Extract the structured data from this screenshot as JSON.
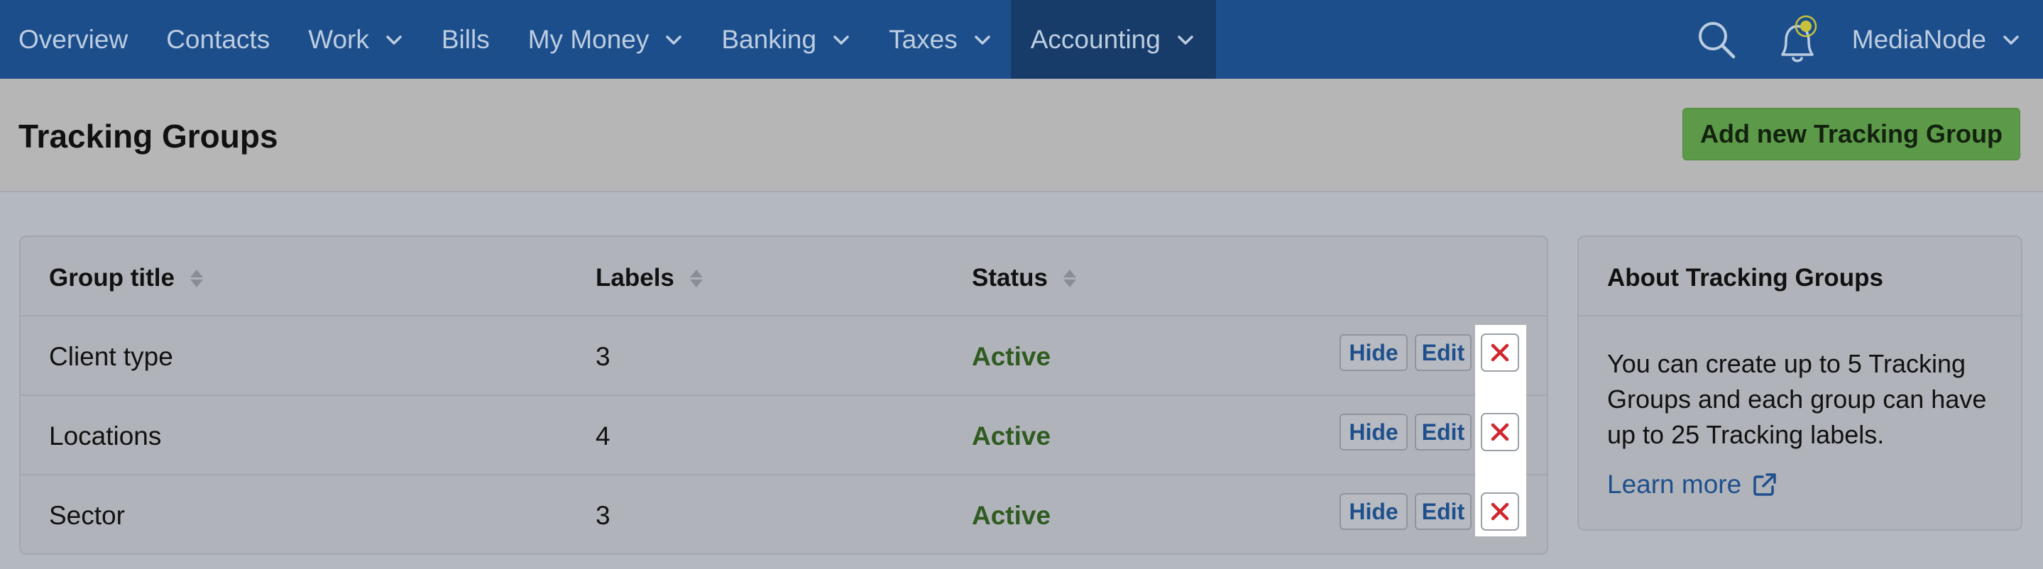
{
  "nav": {
    "items": [
      {
        "label": "Overview",
        "dropdown": false
      },
      {
        "label": "Contacts",
        "dropdown": false
      },
      {
        "label": "Work",
        "dropdown": true
      },
      {
        "label": "Bills",
        "dropdown": false
      },
      {
        "label": "My Money",
        "dropdown": true
      },
      {
        "label": "Banking",
        "dropdown": true
      },
      {
        "label": "Taxes",
        "dropdown": true
      },
      {
        "label": "Accounting",
        "dropdown": true,
        "active": true
      }
    ],
    "search_icon": "search-icon",
    "bell_icon": "notification-bell-icon",
    "user": "MediaNode"
  },
  "header": {
    "title": "Tracking Groups",
    "add_button": "Add new Tracking Group"
  },
  "table": {
    "columns": [
      "Group title",
      "Labels",
      "Status"
    ],
    "rows": [
      {
        "title": "Client type",
        "labels": "3",
        "status": "Active"
      },
      {
        "title": "Locations",
        "labels": "4",
        "status": "Active"
      },
      {
        "title": "Sector",
        "labels": "3",
        "status": "Active"
      }
    ],
    "actions": {
      "hide": "Hide",
      "edit": "Edit",
      "delete_icon": "close-icon"
    }
  },
  "about": {
    "title": "About Tracking Groups",
    "text": "You can create up to 5 Tracking Groups and each group can have up to 25 Tracking labels.",
    "link": "Learn more",
    "link_icon": "external-link-icon"
  },
  "colors": {
    "nav_bg": "#1d4e8c",
    "nav_active_bg": "#173c6a",
    "add_button_bg": "#5c9a49",
    "status_active": "#2f5b20",
    "link": "#1f4f8c",
    "delete_red": "#d0282f"
  }
}
